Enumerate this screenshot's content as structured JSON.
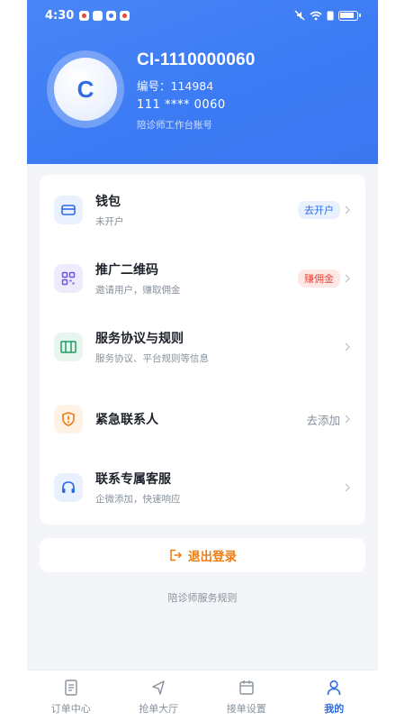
{
  "status_bar": {
    "time": "4:30"
  },
  "profile": {
    "avatar_letter": "C",
    "name": "CI-1110000060",
    "id_line": "编号：114984",
    "phone": "111 **** 0060",
    "note": "陪诊师工作台账号"
  },
  "menu": {
    "items": [
      {
        "title": "钱包",
        "subtitle": "未开户",
        "right_text": "去开户",
        "right_style": "tag-blue",
        "icon": "wallet-icon"
      },
      {
        "title": "推广二维码",
        "subtitle": "邀请用户，赚取佣金",
        "right_text": "赚佣金",
        "right_style": "tag-red",
        "icon": "qr-code-icon"
      },
      {
        "title": "服务协议与规则",
        "subtitle": "服务协议、平台规则等信息",
        "right_text": "",
        "right_style": "",
        "icon": "agreement-book-icon"
      },
      {
        "title": "紧急联系人",
        "subtitle": "",
        "right_text": "去添加",
        "right_style": "plain",
        "icon": "shield-alert-icon"
      },
      {
        "title": "联系专属客服",
        "subtitle": "企微添加，快速响应",
        "right_text": "",
        "right_style": "",
        "icon": "headset-icon"
      }
    ]
  },
  "logout": {
    "label": "退出登录",
    "icon": "logout-icon"
  },
  "rules_link": "陪诊师服务规则",
  "tabbar": {
    "tabs": [
      {
        "label": "订单中心",
        "icon": "order-list-icon",
        "active": false
      },
      {
        "label": "抢单大厅",
        "icon": "navigation-arrow-icon",
        "active": false
      },
      {
        "label": "接单设置",
        "icon": "calendar-icon",
        "active": false
      },
      {
        "label": "我的",
        "icon": "user-icon",
        "active": true
      }
    ]
  },
  "colors": {
    "header_blue": "#3c7bf4",
    "accent_blue": "#2f6be6",
    "accent_red": "#f04438",
    "accent_orange": "#f07b13",
    "page_bg": "#f3f5f9"
  }
}
